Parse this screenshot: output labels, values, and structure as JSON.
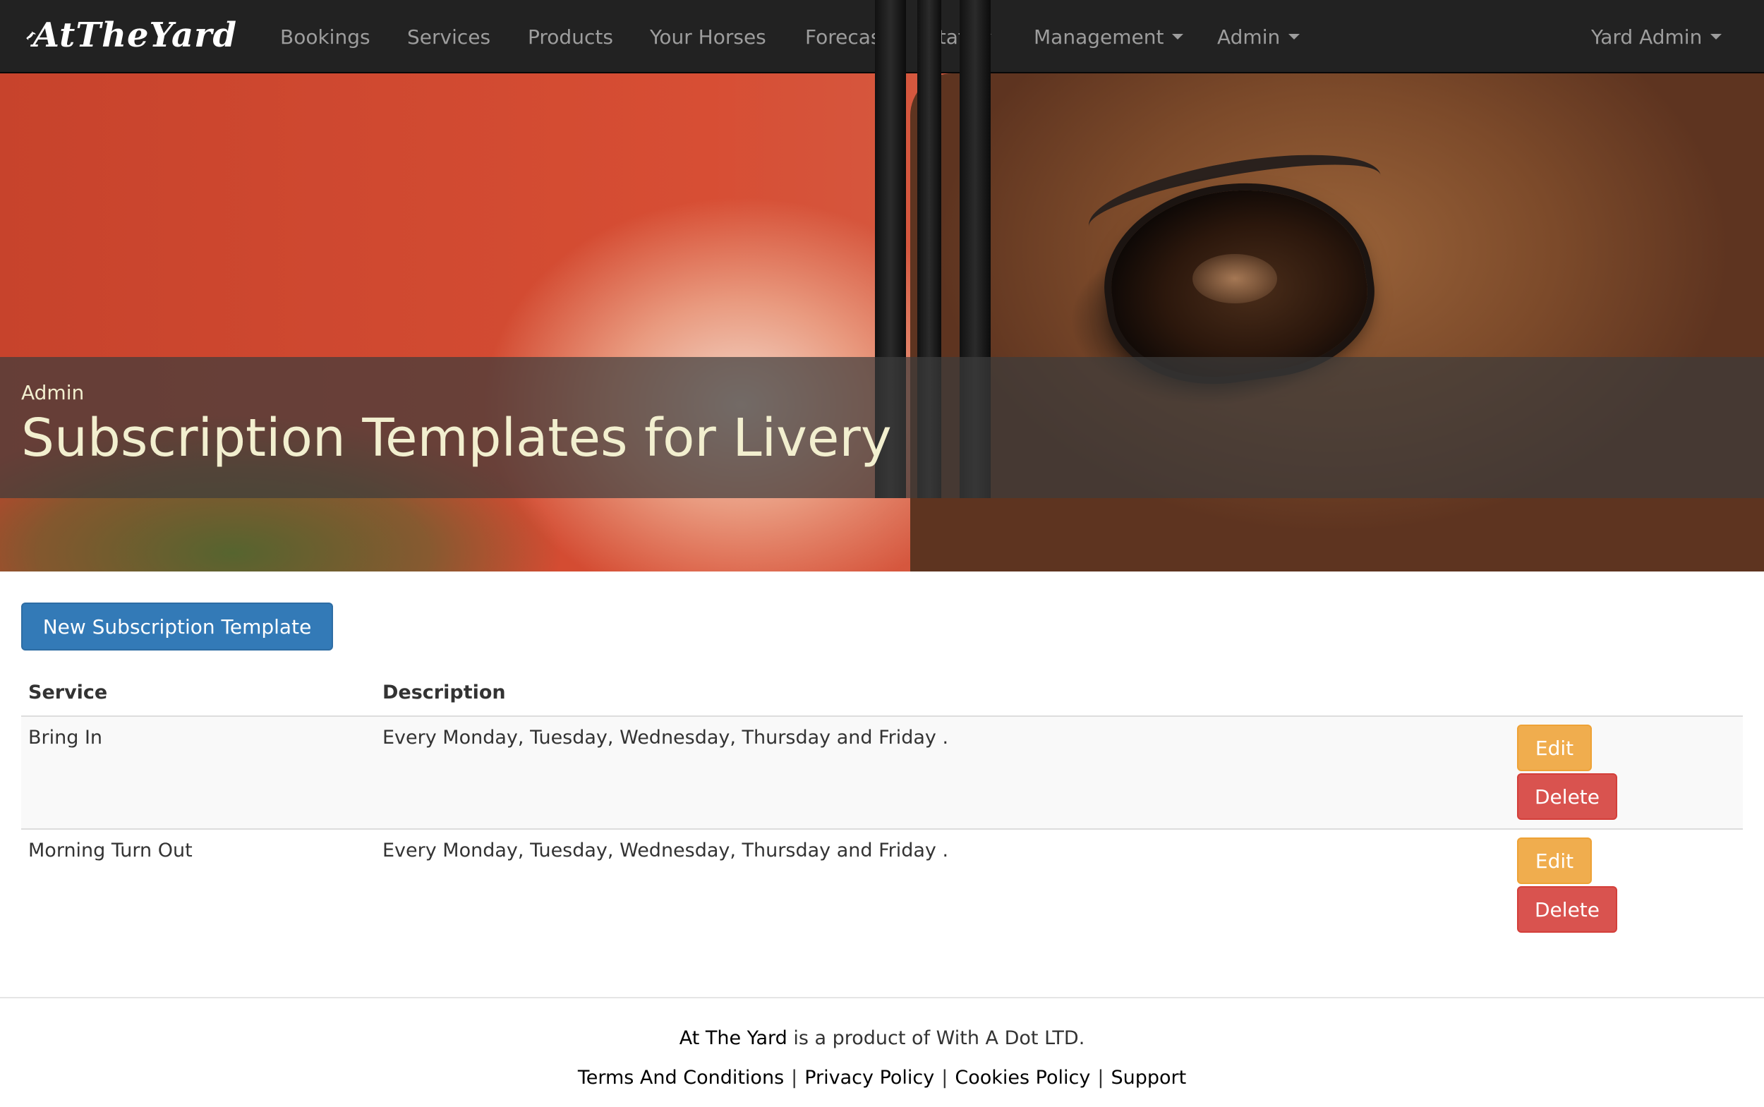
{
  "navbar": {
    "brand": "AtTheYard",
    "items": [
      {
        "label": "Bookings",
        "has_caret": false
      },
      {
        "label": "Services",
        "has_caret": false
      },
      {
        "label": "Products",
        "has_caret": false
      },
      {
        "label": "Your Horses",
        "has_caret": false
      },
      {
        "label": "Forecast",
        "has_caret": false
      },
      {
        "label": "Staff",
        "has_caret": true
      },
      {
        "label": "Management",
        "has_caret": true
      },
      {
        "label": "Admin",
        "has_caret": true
      }
    ],
    "user_menu": "Yard Admin"
  },
  "hero": {
    "section": "Admin",
    "title": "Subscription Templates for Livery"
  },
  "main": {
    "new_button": "New Subscription Template",
    "table": {
      "headers": [
        "Service",
        "Description"
      ],
      "rows": [
        {
          "service": "Bring In",
          "description": "Every Monday, Tuesday, Wednesday, Thursday and Friday .",
          "edit": "Edit",
          "delete": "Delete"
        },
        {
          "service": "Morning Turn Out",
          "description": "Every Monday, Tuesday, Wednesday, Thursday and Friday .",
          "edit": "Edit",
          "delete": "Delete"
        }
      ]
    }
  },
  "footer": {
    "brand": "At The Yard",
    "tagline_rest": " is a product of With A Dot LTD.",
    "links": [
      "Terms And Conditions",
      "Privacy Policy",
      "Cookies Policy",
      "Support"
    ],
    "separator": "|"
  },
  "colors": {
    "navbar_bg": "#222222",
    "nav_text": "#9d9d9d",
    "primary": "#337ab7",
    "warning": "#f0ad4e",
    "danger": "#d9534f",
    "hero_text": "#f2efcf"
  }
}
